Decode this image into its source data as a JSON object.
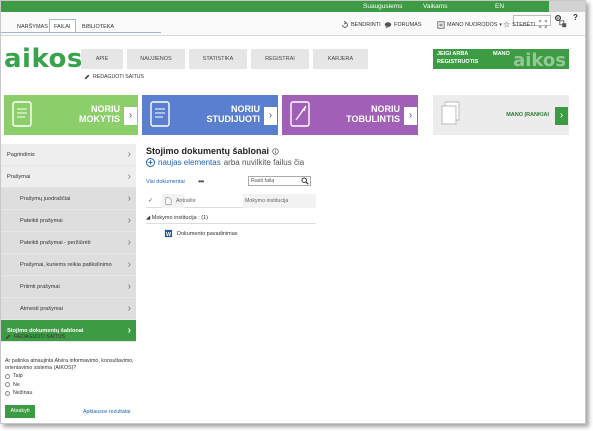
{
  "topbar": {
    "links": [
      "Suaugusiems",
      "Vaikams",
      "EN"
    ]
  },
  "tabs": [
    "NARŠYMAS",
    "FAILAI",
    "BIBLIOTEKA"
  ],
  "active_tab": "FAILAI",
  "toolbar": {
    "share": "BENDRINTI",
    "forums": "FORUMAS",
    "my_links": "MANO NUORODOS",
    "follow": "STEBĖTI"
  },
  "logo": "aikos",
  "menu": [
    "APIE",
    "NAUJIENOS",
    "STATISTIKA",
    "REGISTRAI",
    "KARJERA"
  ],
  "edit_links_label": "REDAGUOTI SAITUS",
  "register": {
    "line1": "JEIGI ARBA",
    "line2": "REGISTRUOTIS",
    "mano": "MANO",
    "ghost_logo": "aikos"
  },
  "tiles": [
    {
      "line1": "NORIU",
      "line2": "MOKYTIS",
      "color": "#8ccf6a"
    },
    {
      "line1": "NORIU",
      "line2": "STUDIJUOTI",
      "color": "#5b7fcf"
    },
    {
      "line1": "NORIU",
      "line2": "TOBULINTIS",
      "color": "#a25fb8"
    },
    {
      "label": "MANO ĮRANKIAI",
      "color": "#3d9b43"
    }
  ],
  "leftnav": [
    {
      "label": "Pagrindinis",
      "type": "top"
    },
    {
      "label": "Prašymai",
      "type": "top"
    },
    {
      "label": "Prašymų juodraščiai",
      "type": "sub"
    },
    {
      "label": "Pateikti prašymai",
      "type": "sub"
    },
    {
      "label": "Pateikti prašymai - peržiūrėti",
      "type": "sub"
    },
    {
      "label": "Prašymai, kuriems reikia patikslinimo",
      "type": "sub"
    },
    {
      "label": "Priimti prašymai",
      "type": "sub"
    },
    {
      "label": "Atmesti prašymai",
      "type": "sub"
    },
    {
      "label": "Stojimo dokumentų šablonai",
      "type": "active"
    }
  ],
  "poll": {
    "question": "Ar patinka atnaujinta Atvira informavimo, konsultavimo, orientavimo sistema (AIKOS)?",
    "options": [
      "Taip",
      "Ne",
      "Nežinau"
    ],
    "vote_label": "Atsakyti",
    "results_label": "Apklausos rezultatai"
  },
  "main": {
    "title": "Stojimo dokumentų šablonai",
    "new_link": "naujas elementas",
    "new_rest": "arba nuvilkite failus čia",
    "view_label": "Visi dokumentai",
    "search_placeholder": "Rasti failą",
    "col_title": "Antraštė",
    "col_institution": "Mokymo institucija",
    "group_label": "Mokymo institucija : (1)",
    "document_name": "Dokumento pavadinimas"
  }
}
